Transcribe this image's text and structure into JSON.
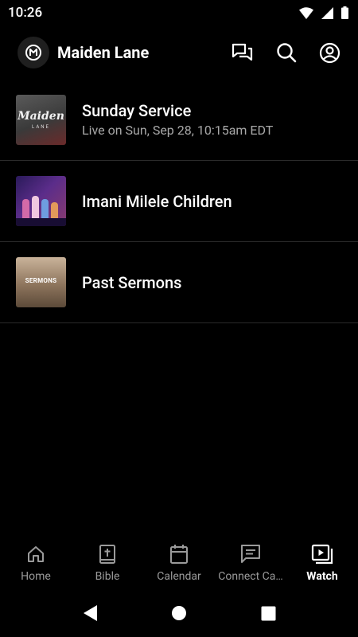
{
  "status_bar": {
    "time": "10:26"
  },
  "header": {
    "title": "Maiden Lane"
  },
  "list": [
    {
      "title": "Sunday Service",
      "subtitle": "Live on Sun, Sep 28, 10:15am EDT",
      "thumb_text_1": "Maiden",
      "thumb_text_2": "LANE"
    },
    {
      "title": "Imani Milele Children"
    },
    {
      "title": "Past Sermons",
      "thumb_text": "SERMONS"
    }
  ],
  "bottom_nav": [
    {
      "label": "Home",
      "icon": "home-icon"
    },
    {
      "label": "Bible",
      "icon": "bible-icon"
    },
    {
      "label": "Calendar",
      "icon": "calendar-icon"
    },
    {
      "label": "Connect Ca…",
      "icon": "connect-card-icon"
    },
    {
      "label": "Watch",
      "icon": "watch-icon",
      "active": true
    }
  ],
  "colors": {
    "background": "#000000",
    "inactive": "#9a9a9a",
    "active": "#ffffff"
  }
}
